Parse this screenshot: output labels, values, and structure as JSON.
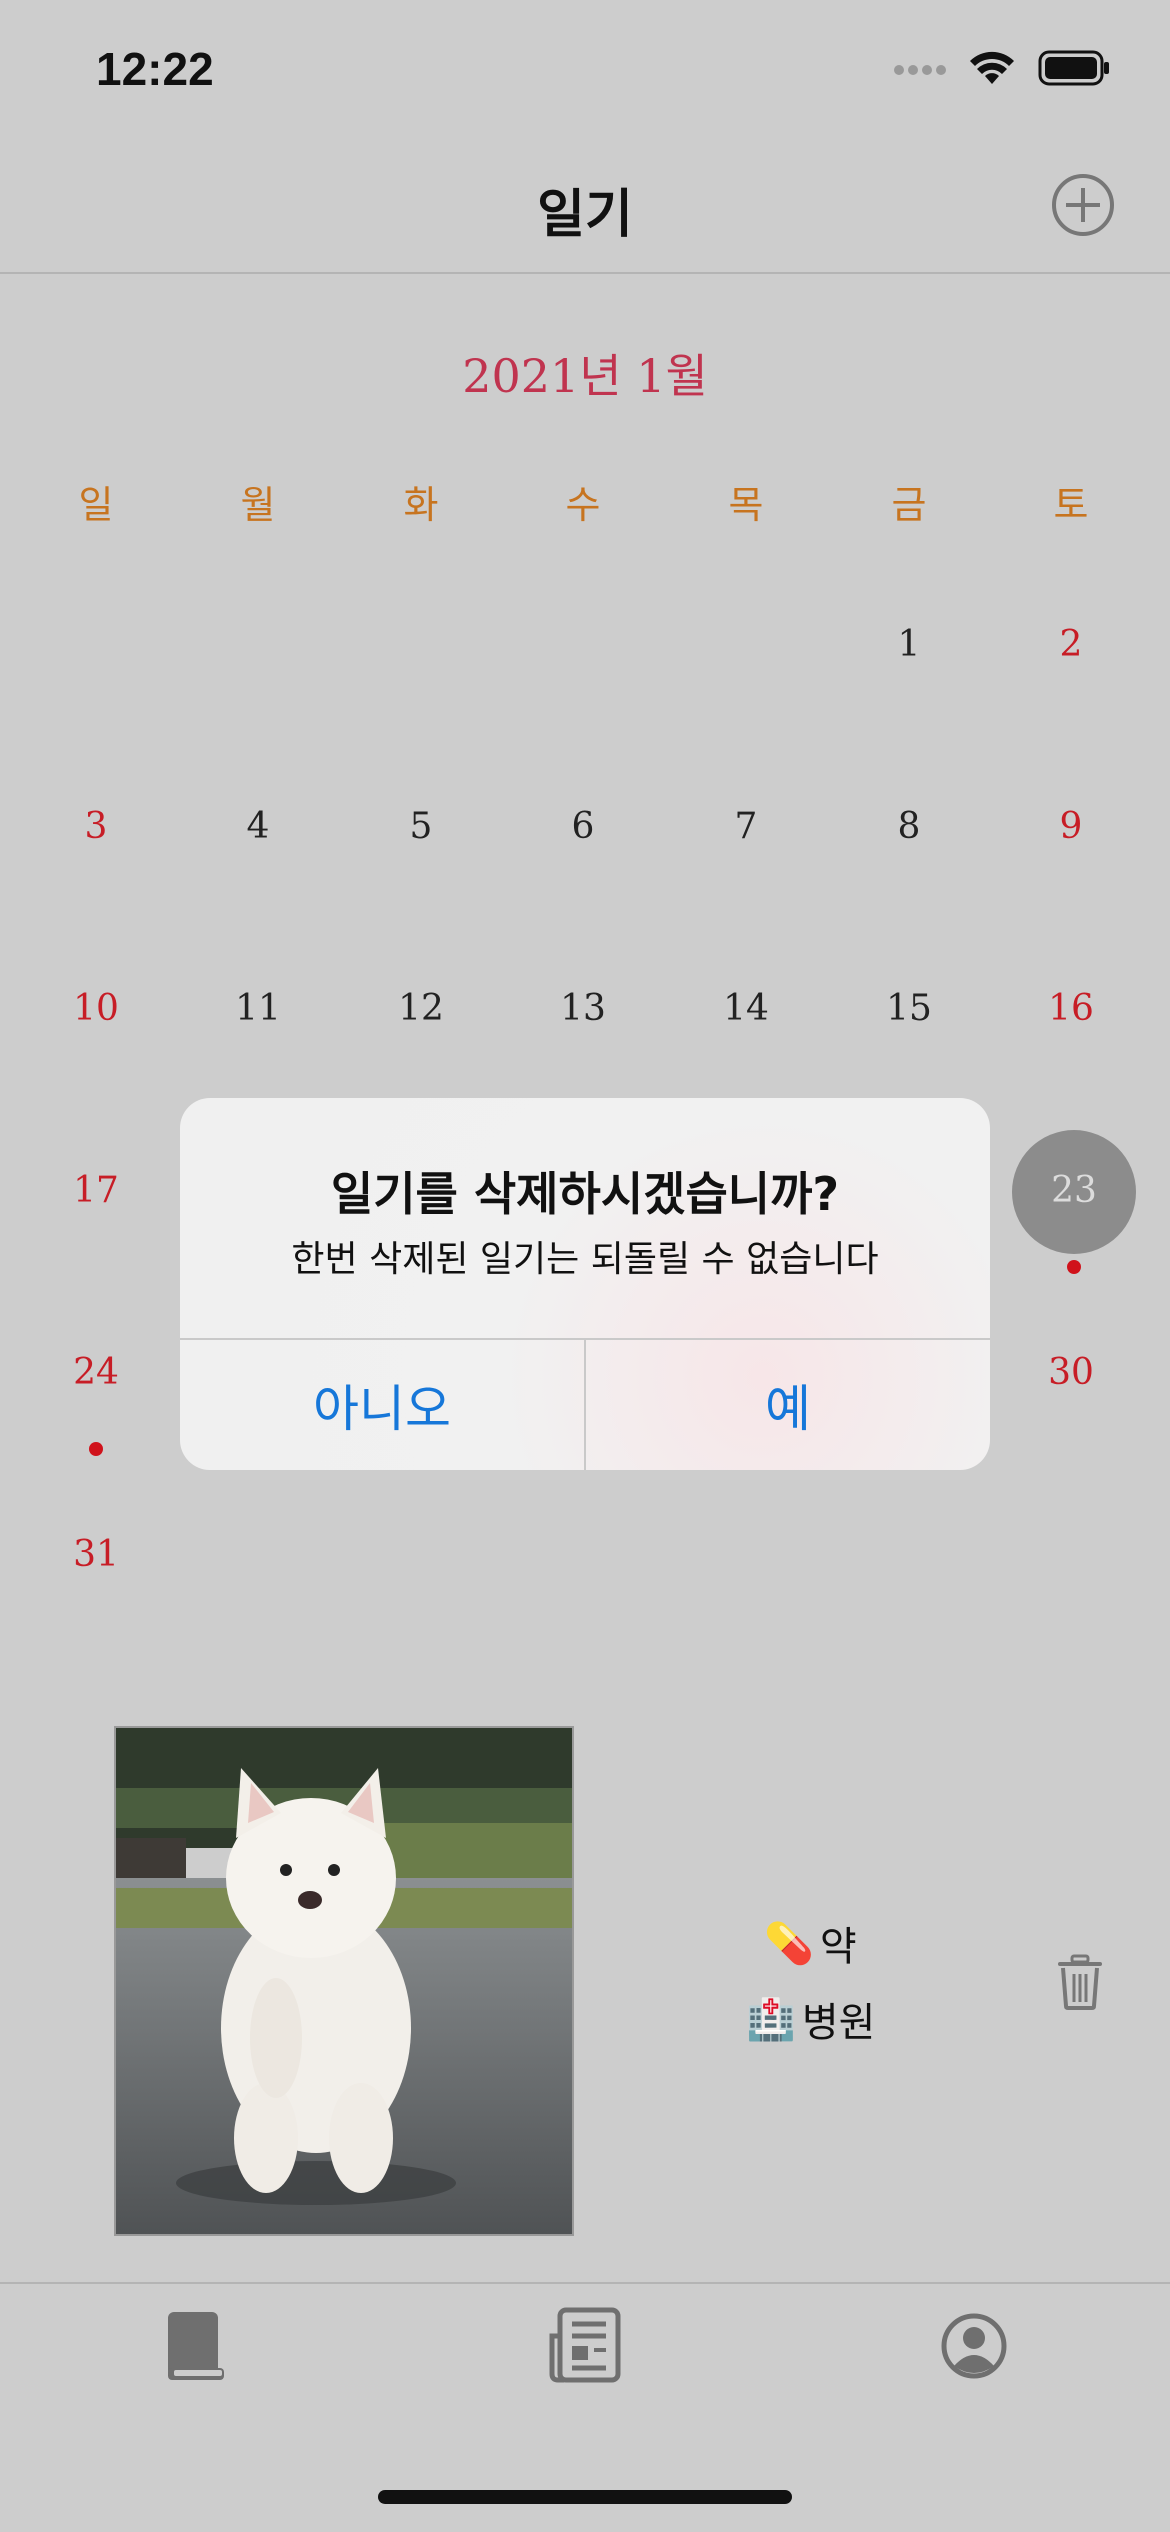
{
  "status_bar": {
    "time": "12:22"
  },
  "nav": {
    "title": "일기"
  },
  "calendar": {
    "month_title": "2021년 1월",
    "weekdays": [
      "일",
      "월",
      "화",
      "수",
      "목",
      "금",
      "토"
    ],
    "days": {
      "d1": "1",
      "d2": "2",
      "d3": "3",
      "d4": "4",
      "d5": "5",
      "d6": "6",
      "d7": "7",
      "d8": "8",
      "d9": "9",
      "d10": "10",
      "d11": "11",
      "d12": "12",
      "d13": "13",
      "d14": "14",
      "d15": "15",
      "d16": "16",
      "d17": "17",
      "d23": "23",
      "d24": "24",
      "d30": "30",
      "d31": "31"
    },
    "selected_day": "23"
  },
  "alert": {
    "title": "일기를 삭제하시겠습니까?",
    "message": "한번 삭제된 일기는 되돌릴 수 없습니다",
    "cancel_label": "아니오",
    "confirm_label": "예"
  },
  "entry": {
    "tags": [
      {
        "emoji": "💊",
        "label": "약"
      },
      {
        "emoji": "🏥",
        "label": "병원"
      }
    ]
  },
  "tabs": [
    "book-icon",
    "newspaper-icon",
    "profile-icon"
  ],
  "colors": {
    "accent_blue": "#1677d9",
    "month_red": "#c0344f",
    "weekday_orange": "#c7741f",
    "weekend_red": "#c71d26"
  }
}
